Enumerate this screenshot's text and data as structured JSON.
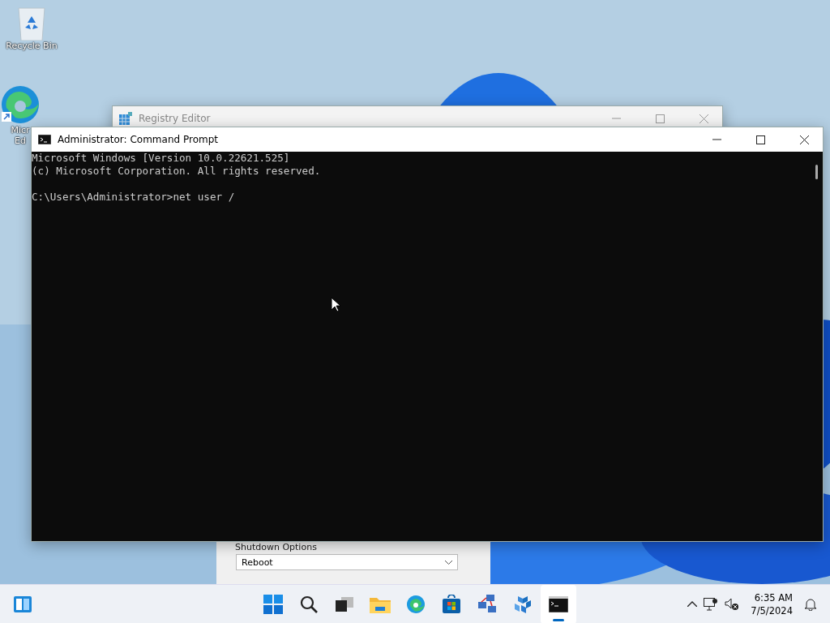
{
  "desktop_icons": [
    {
      "kind": "recycle",
      "label_lines": [
        "Recycle Bin"
      ]
    },
    {
      "kind": "edge",
      "label_lines": [
        "Micr",
        "Ed"
      ]
    }
  ],
  "background_window": {
    "title": "Registry Editor"
  },
  "shutdown_dialog": {
    "group_label": "Shutdown Options",
    "dropdown_value": "Reboot"
  },
  "console_window": {
    "title": "Administrator: Command Prompt",
    "lines": [
      "Microsoft Windows [Version 10.0.22621.525]",
      "(c) Microsoft Corporation. All rights reserved."
    ],
    "prompt_line": "C:\\Users\\Administrator>net user /"
  },
  "taskbar": {
    "apps": [
      {
        "kind": "start",
        "active": false
      },
      {
        "kind": "search",
        "active": false
      },
      {
        "kind": "taskview",
        "active": false
      },
      {
        "kind": "explorer",
        "active": false
      },
      {
        "kind": "edge",
        "active": false
      },
      {
        "kind": "store",
        "active": false
      },
      {
        "kind": "network",
        "active": false
      },
      {
        "kind": "cubes",
        "active": false
      },
      {
        "kind": "console",
        "active": true
      }
    ],
    "time": "6:35 AM",
    "date": "7/5/2024"
  }
}
